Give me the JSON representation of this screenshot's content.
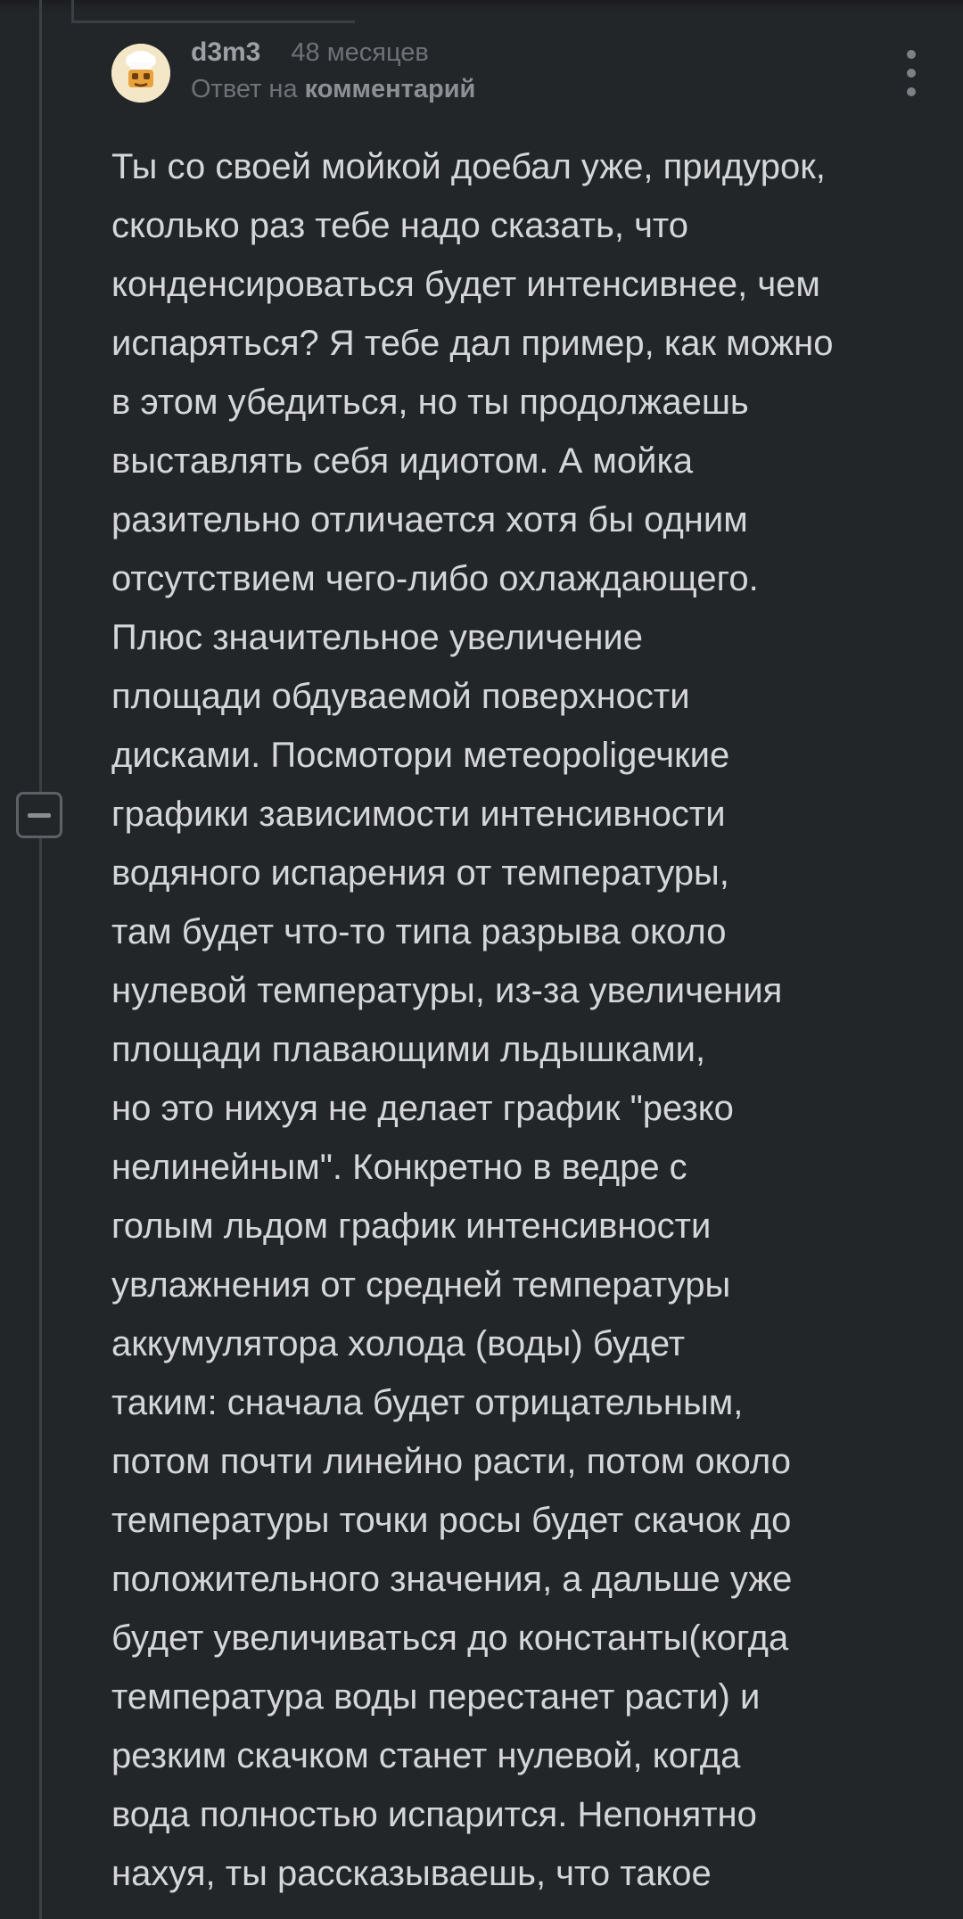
{
  "comment": {
    "author": "d3m3",
    "time": "48 месяцев",
    "reply_prefix": "Ответ на",
    "reply_link": "комментарий",
    "collapse_icon": "minus-square-icon",
    "more_icon": "vertical-dots-icon",
    "lines": [
      "Ты со своей мойкой доебал уже, придурок,",
      "сколько раз тебе надо сказать, что",
      "конденсироваться будет интенсивнее, чем",
      "испаряться? Я тебе дал пример, как можно",
      "в этом убедиться, но ты продолжаешь",
      "выставлять себя идиотом. А мойка",
      "разительно отличается хотя бы одним",
      "отсутствием чего-либо охлаждающего.",
      "Плюс значительное увеличение",
      "площади обдуваемой поверхности",
      "дисками. Посмотори метеороligечкие",
      "графики зависимости интенсивности",
      "водяного испарения от температуры,",
      "там будет что-то типа разрыва около",
      "нулевой температуры, из-за увеличения",
      "площади плавающими льдышками,",
      "но это нихуя не делает график \"резко",
      "нелинейным\". Конкретно в ведре с",
      "голым льдом график интенсивности",
      "увлажнения от средней температуры",
      "аккумулятора холода (воды) будет",
      "таким: сначала будет отрицательным,",
      "потом почти линейно расти, потом около",
      "температуры точки росы будет скачок до",
      "положительного значения, а дальше уже",
      "будет увеличиваться до константы(когда",
      "температура воды перестанет расти) и",
      "резким скачком станет нулевой, когда",
      "вода полностью испарится. Непонятно",
      "нахуя, ты рассказываешь, что такое"
    ]
  }
}
